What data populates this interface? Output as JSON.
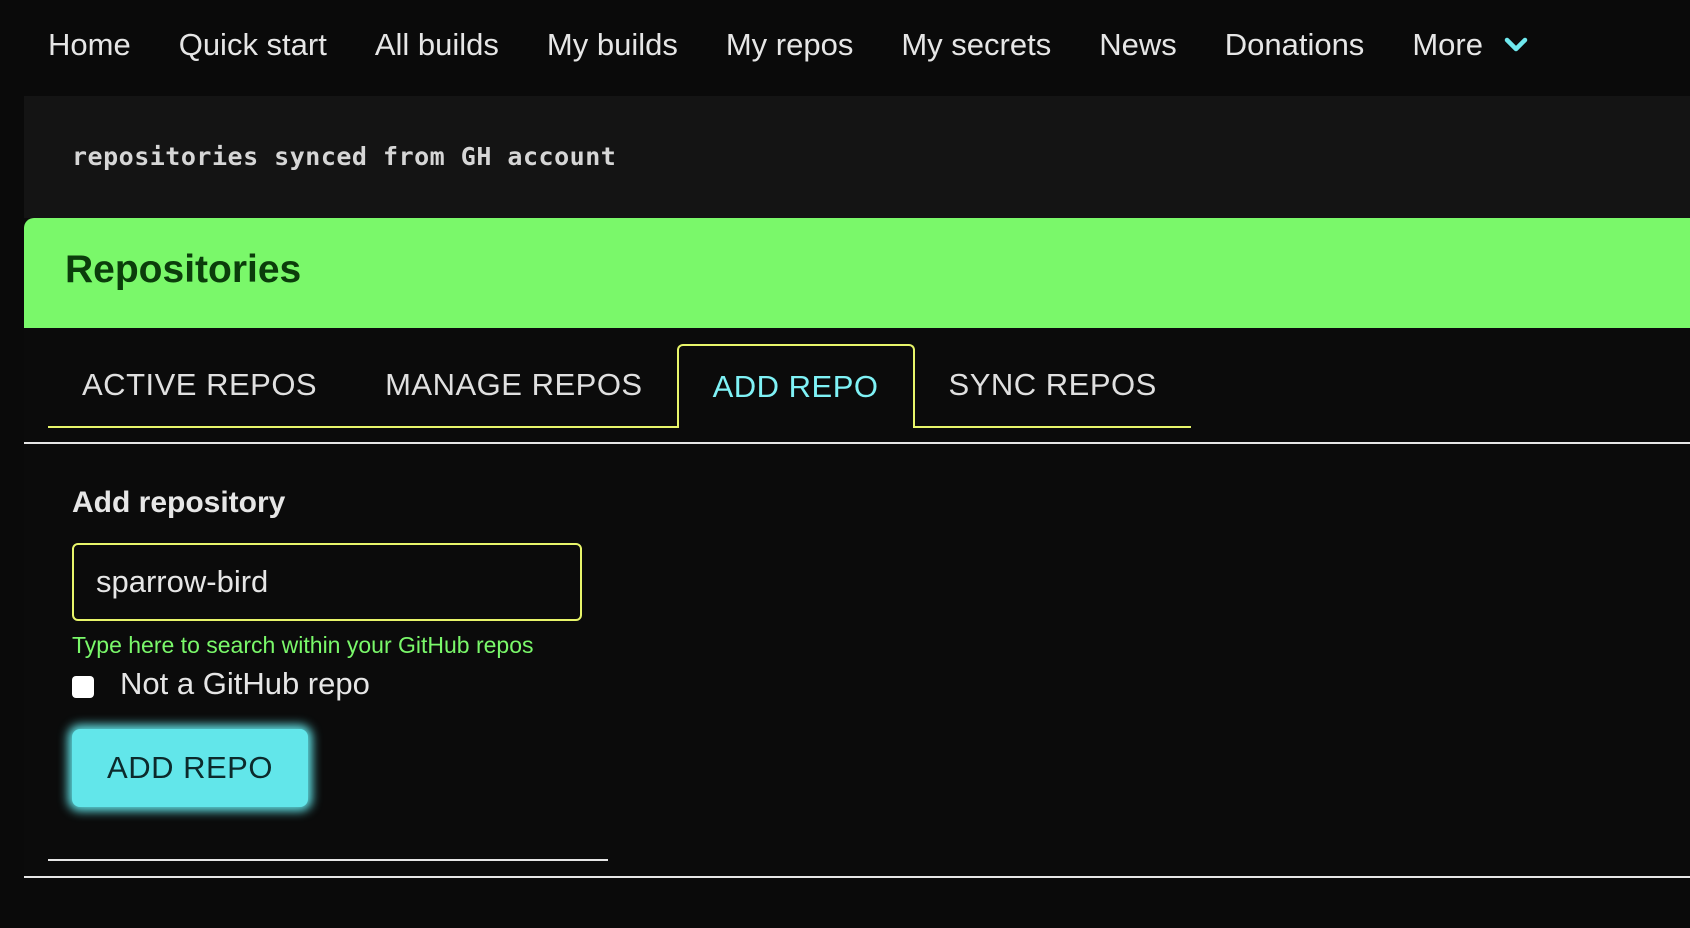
{
  "nav": {
    "items": [
      "Home",
      "Quick start",
      "All builds",
      "My builds",
      "My repos",
      "My secrets",
      "News",
      "Donations"
    ],
    "more_label": "More",
    "more_icon": "chevron-down-icon"
  },
  "subtitle": "repositories synced from GH account",
  "header": {
    "title": "Repositories"
  },
  "tabs": [
    {
      "label": "ACTIVE REPOS",
      "active": false
    },
    {
      "label": "MANAGE REPOS",
      "active": false
    },
    {
      "label": "ADD REPO",
      "active": true
    },
    {
      "label": "SYNC REPOS",
      "active": false
    }
  ],
  "form": {
    "section_title": "Add repository",
    "repo_input_value": "sparrow-bird",
    "helper_text": "Type here to search within your GitHub repos",
    "checkbox_label": "Not a GitHub repo",
    "checkbox_checked": false,
    "submit_label": "ADD REPO"
  },
  "colors": {
    "header_green": "#7af86a",
    "accent_cyan": "#62e6ea",
    "tab_border_yellow": "#e8f56a",
    "active_tab_text": "#7ff2f6"
  }
}
